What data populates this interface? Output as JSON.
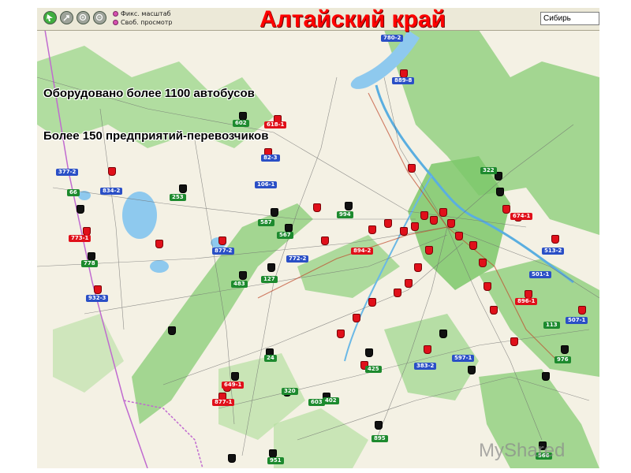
{
  "title": "Алтайский край",
  "toolbar": {
    "buttons": [
      {
        "icon": "navigate-icon",
        "color": "#3fae3f"
      },
      {
        "icon": "pan-icon",
        "color": "#9ea39a"
      },
      {
        "icon": "zoom-in-icon",
        "color": "#9ea39a"
      },
      {
        "icon": "zoom-out-icon",
        "color": "#9ea39a"
      }
    ],
    "options": [
      "Фикс. масштаб",
      "Своб. просмотр"
    ],
    "region": "Сибирь"
  },
  "notes": {
    "buses": "Оборудовано более 1100 автобусов",
    "carriers": "Более 150 предприятий-перевозчиков"
  },
  "route_labels": [
    {
      "text": "780-2",
      "color": "blue"
    },
    {
      "text": "889-8",
      "color": "blue"
    },
    {
      "text": "602",
      "color": "green"
    },
    {
      "text": "618-1",
      "color": "red"
    },
    {
      "text": "82-3",
      "color": "blue"
    },
    {
      "text": "106-1",
      "color": "blue"
    },
    {
      "text": "377-2",
      "color": "blue"
    },
    {
      "text": "66",
      "color": "green"
    },
    {
      "text": "834-2",
      "color": "blue"
    },
    {
      "text": "253",
      "color": "green"
    },
    {
      "text": "773-1",
      "color": "red"
    },
    {
      "text": "778",
      "color": "green"
    },
    {
      "text": "932-3",
      "color": "blue"
    },
    {
      "text": "877-2",
      "color": "blue"
    },
    {
      "text": "483",
      "color": "green"
    },
    {
      "text": "127",
      "color": "green"
    },
    {
      "text": "587",
      "color": "green"
    },
    {
      "text": "567",
      "color": "green"
    },
    {
      "text": "772-2",
      "color": "blue"
    },
    {
      "text": "994",
      "color": "green"
    },
    {
      "text": "894-2",
      "color": "red"
    },
    {
      "text": "322",
      "color": "green"
    },
    {
      "text": "513-2",
      "color": "blue"
    },
    {
      "text": "501-1",
      "color": "blue"
    },
    {
      "text": "896-1",
      "color": "red"
    },
    {
      "text": "507-1",
      "color": "blue"
    },
    {
      "text": "113",
      "color": "green"
    },
    {
      "text": "976",
      "color": "green"
    },
    {
      "text": "425",
      "color": "green"
    },
    {
      "text": "383-2",
      "color": "blue"
    },
    {
      "text": "597-1",
      "color": "blue"
    },
    {
      "text": "320",
      "color": "green"
    },
    {
      "text": "402",
      "color": "green"
    },
    {
      "text": "603",
      "color": "green"
    },
    {
      "text": "895",
      "color": "green"
    },
    {
      "text": "566",
      "color": "green"
    },
    {
      "text": "951",
      "color": "green"
    },
    {
      "text": "877-1",
      "color": "red"
    },
    {
      "text": "649-1",
      "color": "red"
    },
    {
      "text": "24",
      "color": "green"
    },
    {
      "text": "674-1",
      "color": "red"
    }
  ],
  "watermark": "MyShared"
}
